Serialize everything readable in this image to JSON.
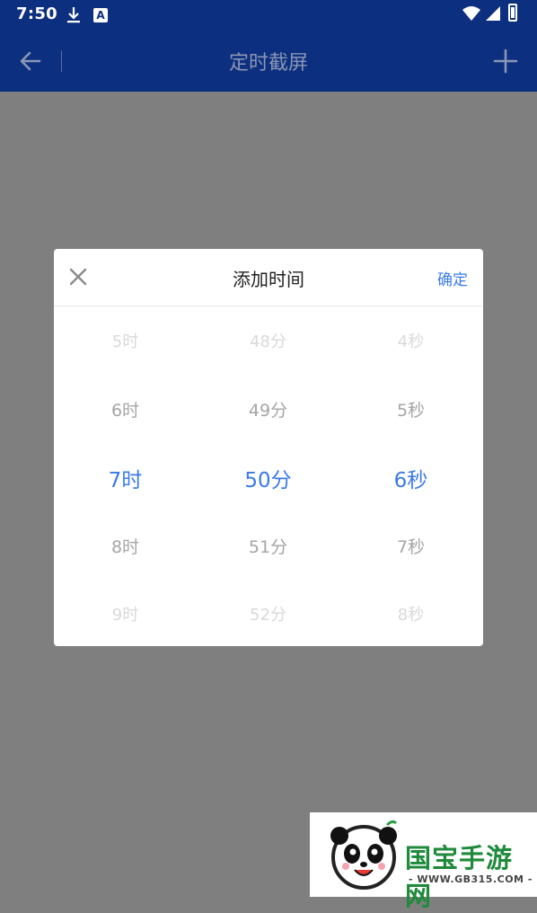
{
  "status_bar": {
    "time": "7:50",
    "icons": [
      "download-icon",
      "android-auto-icon",
      "wifi-icon",
      "signal-icon",
      "battery-charging-icon"
    ]
  },
  "app_bar": {
    "title": "定时截屏",
    "back_icon": "arrow-left-icon",
    "add_icon": "plus-icon"
  },
  "dialog": {
    "title": "添加时间",
    "confirm_label": "确定",
    "close_icon": "close-icon",
    "accent": "#3b7ae8",
    "hours": [
      "5时",
      "6时",
      "7时",
      "8时",
      "9时"
    ],
    "minutes": [
      "48分",
      "49分",
      "50分",
      "51分",
      "52分"
    ],
    "seconds": [
      "4秒",
      "5秒",
      "6秒",
      "7秒",
      "8秒"
    ],
    "selected": {
      "hour": "7时",
      "minute": "50分",
      "second": "6秒"
    }
  },
  "watermark": {
    "brand": "国宝手游网",
    "url": "- WWW.GB315.COM -"
  },
  "colors": {
    "app_bar": "#0d2f7f",
    "overlay": "#7f7f7f"
  }
}
